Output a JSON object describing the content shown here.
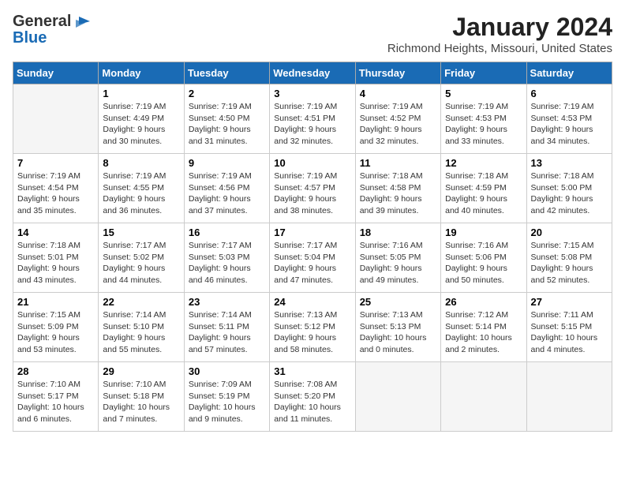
{
  "header": {
    "logo_general": "General",
    "logo_blue": "Blue",
    "month_year": "January 2024",
    "location": "Richmond Heights, Missouri, United States"
  },
  "days_of_week": [
    "Sunday",
    "Monday",
    "Tuesday",
    "Wednesday",
    "Thursday",
    "Friday",
    "Saturday"
  ],
  "weeks": [
    [
      {
        "day": "",
        "empty": true
      },
      {
        "day": "1",
        "sunrise": "7:19 AM",
        "sunset": "4:49 PM",
        "daylight": "9 hours and 30 minutes."
      },
      {
        "day": "2",
        "sunrise": "7:19 AM",
        "sunset": "4:50 PM",
        "daylight": "9 hours and 31 minutes."
      },
      {
        "day": "3",
        "sunrise": "7:19 AM",
        "sunset": "4:51 PM",
        "daylight": "9 hours and 32 minutes."
      },
      {
        "day": "4",
        "sunrise": "7:19 AM",
        "sunset": "4:52 PM",
        "daylight": "9 hours and 32 minutes."
      },
      {
        "day": "5",
        "sunrise": "7:19 AM",
        "sunset": "4:53 PM",
        "daylight": "9 hours and 33 minutes."
      },
      {
        "day": "6",
        "sunrise": "7:19 AM",
        "sunset": "4:53 PM",
        "daylight": "9 hours and 34 minutes."
      }
    ],
    [
      {
        "day": "7",
        "sunrise": "7:19 AM",
        "sunset": "4:54 PM",
        "daylight": "9 hours and 35 minutes."
      },
      {
        "day": "8",
        "sunrise": "7:19 AM",
        "sunset": "4:55 PM",
        "daylight": "9 hours and 36 minutes."
      },
      {
        "day": "9",
        "sunrise": "7:19 AM",
        "sunset": "4:56 PM",
        "daylight": "9 hours and 37 minutes."
      },
      {
        "day": "10",
        "sunrise": "7:19 AM",
        "sunset": "4:57 PM",
        "daylight": "9 hours and 38 minutes."
      },
      {
        "day": "11",
        "sunrise": "7:18 AM",
        "sunset": "4:58 PM",
        "daylight": "9 hours and 39 minutes."
      },
      {
        "day": "12",
        "sunrise": "7:18 AM",
        "sunset": "4:59 PM",
        "daylight": "9 hours and 40 minutes."
      },
      {
        "day": "13",
        "sunrise": "7:18 AM",
        "sunset": "5:00 PM",
        "daylight": "9 hours and 42 minutes."
      }
    ],
    [
      {
        "day": "14",
        "sunrise": "7:18 AM",
        "sunset": "5:01 PM",
        "daylight": "9 hours and 43 minutes."
      },
      {
        "day": "15",
        "sunrise": "7:17 AM",
        "sunset": "5:02 PM",
        "daylight": "9 hours and 44 minutes."
      },
      {
        "day": "16",
        "sunrise": "7:17 AM",
        "sunset": "5:03 PM",
        "daylight": "9 hours and 46 minutes."
      },
      {
        "day": "17",
        "sunrise": "7:17 AM",
        "sunset": "5:04 PM",
        "daylight": "9 hours and 47 minutes."
      },
      {
        "day": "18",
        "sunrise": "7:16 AM",
        "sunset": "5:05 PM",
        "daylight": "9 hours and 49 minutes."
      },
      {
        "day": "19",
        "sunrise": "7:16 AM",
        "sunset": "5:06 PM",
        "daylight": "9 hours and 50 minutes."
      },
      {
        "day": "20",
        "sunrise": "7:15 AM",
        "sunset": "5:08 PM",
        "daylight": "9 hours and 52 minutes."
      }
    ],
    [
      {
        "day": "21",
        "sunrise": "7:15 AM",
        "sunset": "5:09 PM",
        "daylight": "9 hours and 53 minutes."
      },
      {
        "day": "22",
        "sunrise": "7:14 AM",
        "sunset": "5:10 PM",
        "daylight": "9 hours and 55 minutes."
      },
      {
        "day": "23",
        "sunrise": "7:14 AM",
        "sunset": "5:11 PM",
        "daylight": "9 hours and 57 minutes."
      },
      {
        "day": "24",
        "sunrise": "7:13 AM",
        "sunset": "5:12 PM",
        "daylight": "9 hours and 58 minutes."
      },
      {
        "day": "25",
        "sunrise": "7:13 AM",
        "sunset": "5:13 PM",
        "daylight": "10 hours and 0 minutes."
      },
      {
        "day": "26",
        "sunrise": "7:12 AM",
        "sunset": "5:14 PM",
        "daylight": "10 hours and 2 minutes."
      },
      {
        "day": "27",
        "sunrise": "7:11 AM",
        "sunset": "5:15 PM",
        "daylight": "10 hours and 4 minutes."
      }
    ],
    [
      {
        "day": "28",
        "sunrise": "7:10 AM",
        "sunset": "5:17 PM",
        "daylight": "10 hours and 6 minutes."
      },
      {
        "day": "29",
        "sunrise": "7:10 AM",
        "sunset": "5:18 PM",
        "daylight": "10 hours and 7 minutes."
      },
      {
        "day": "30",
        "sunrise": "7:09 AM",
        "sunset": "5:19 PM",
        "daylight": "10 hours and 9 minutes."
      },
      {
        "day": "31",
        "sunrise": "7:08 AM",
        "sunset": "5:20 PM",
        "daylight": "10 hours and 11 minutes."
      },
      {
        "day": "",
        "empty": true
      },
      {
        "day": "",
        "empty": true
      },
      {
        "day": "",
        "empty": true
      }
    ]
  ]
}
